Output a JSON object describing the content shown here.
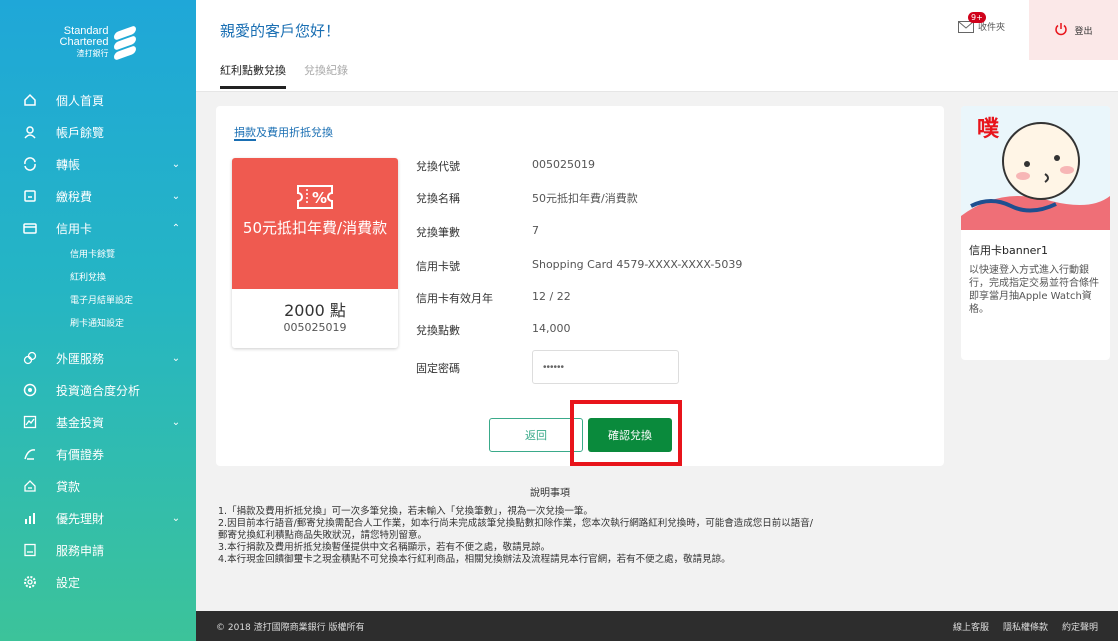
{
  "brand": {
    "line1": "Standard",
    "line2": "Chartered",
    "line3": "渣打銀行"
  },
  "sidebar": {
    "items": [
      {
        "label": "個人首頁",
        "icon": "home-icon"
      },
      {
        "label": "帳戶餘覽",
        "icon": "user-icon"
      },
      {
        "label": "轉帳",
        "icon": "transfer-icon"
      },
      {
        "label": "繳稅費",
        "icon": "bill-icon"
      },
      {
        "label": "信用卡",
        "icon": "credit-card-icon"
      },
      {
        "label": "外匯服務",
        "icon": "fx-icon"
      },
      {
        "label": "投資適合度分析",
        "icon": "analysis-icon"
      },
      {
        "label": "基金投資",
        "icon": "fund-icon"
      },
      {
        "label": "有價證券",
        "icon": "securities-icon"
      },
      {
        "label": "貸款",
        "icon": "loan-icon"
      },
      {
        "label": "優先理財",
        "icon": "priority-icon"
      },
      {
        "label": "服務申請",
        "icon": "service-icon"
      },
      {
        "label": "設定",
        "icon": "settings-icon"
      }
    ],
    "credit_sub": [
      "信用卡餘覽",
      "紅利兌換",
      "電子月結單設定",
      "刷卡通知設定"
    ]
  },
  "header": {
    "greeting": "親愛的客戶您好！",
    "tabs": [
      "紅利點數兌換",
      "兌換紀錄"
    ],
    "inbox_label": "收件夾",
    "inbox_badge": "9+",
    "logout_label": "登出"
  },
  "card": {
    "title": "捐款及費用折抵兌換",
    "coupon_name": "50元抵扣年費/消費款",
    "coupon_points": "2000 點",
    "coupon_code": "005025019",
    "fields": [
      {
        "k": "兌換代號",
        "v": "005025019"
      },
      {
        "k": "兌換名稱",
        "v": "50元抵扣年費/消費款"
      },
      {
        "k": "兌換筆數",
        "v": "7"
      },
      {
        "k": "信用卡號",
        "v": "Shopping Card 4579-XXXX-XXXX-5039"
      },
      {
        "k": "信用卡有效月年",
        "v": "12 / 22"
      },
      {
        "k": "兌換點數",
        "v": "14,000"
      }
    ],
    "password_label": "固定密碼",
    "password_value": "••••••",
    "back_label": "返回",
    "confirm_label": "確認兌換"
  },
  "notes": {
    "title": "說明事項",
    "lines": [
      "1.「捐款及費用折抵兌換」可一次多筆兌換，若未輸入「兌換筆數」，視為一次兌換一筆。",
      "2.因目前本行語音/郵寄兌換需配合人工作業，如本行尚未完成該筆兌換點數扣除作業，您本次執行網路紅利兌換時，可能會造成您日前以語音/",
      "郵寄兌換紅利積點商品失敗狀況，請您特別留意。",
      "3.本行捐款及費用折抵兌換暫僅提供中文名稱顯示，若有不便之處，敬請見諒。",
      "4.本行現金回饋御璽卡之現金積點不可兌換本行紅利商品，相關兌換辦法及流程請見本行官網，若有不便之處，敬請見諒。"
    ]
  },
  "banner": {
    "image_text": "噗",
    "title": "信用卡banner1",
    "text": "以快速登入方式進入行動銀行，完成指定交易並符合條件即享當月抽Apple Watch資格。"
  },
  "footer": {
    "copyright": "© 2018 渣打國際商業銀行 版權所有",
    "links": [
      "線上客服",
      "隱私權條款",
      "約定聲明"
    ]
  }
}
